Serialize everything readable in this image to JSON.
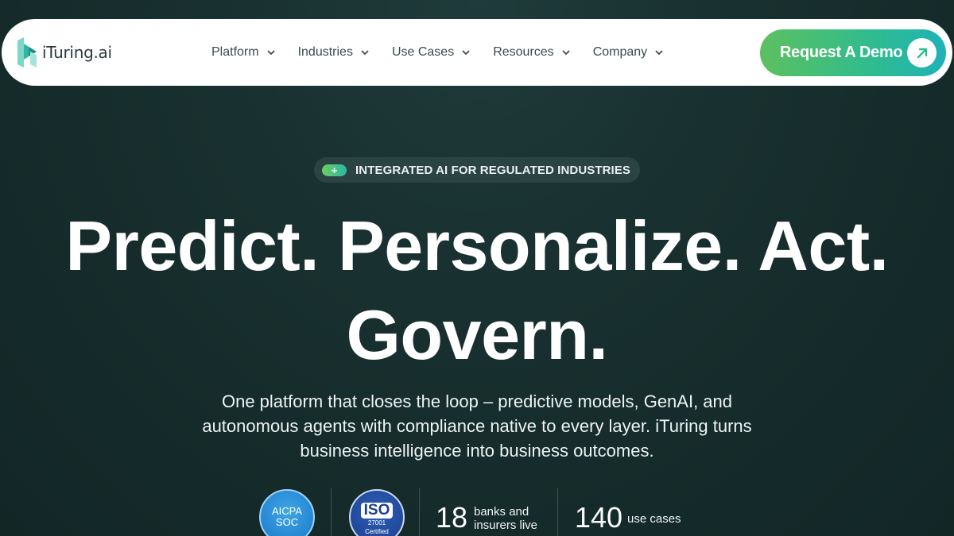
{
  "brand": {
    "name": "iTuring.ai",
    "logo_icon": "ituring-logo-icon"
  },
  "nav": {
    "items": [
      {
        "label": "Platform"
      },
      {
        "label": "Industries"
      },
      {
        "label": "Use Cases"
      },
      {
        "label": "Resources"
      },
      {
        "label": "Company"
      }
    ],
    "cta_label": "Request A Demo",
    "cta_icon": "arrow-up-right-icon"
  },
  "hero": {
    "badge_icon": "plus-icon",
    "badge_text": "INTEGRATED AI FOR REGULATED INDUSTRIES",
    "headline_line1": "Predict. Personalize. Act.",
    "headline_line2": "Govern.",
    "subtext": "One platform that closes the loop – predictive models, GenAI, and autonomous agents with compliance native to every layer. iTuring turns business intelligence into business outcomes."
  },
  "stats": {
    "aicpa": {
      "line1": "AICPA",
      "line2": "SOC"
    },
    "iso": {
      "main": "ISO",
      "code": "27001",
      "status": "Certified"
    },
    "banks": {
      "value": "18",
      "label_line1": "banks and",
      "label_line2": "insurers live"
    },
    "use_cases": {
      "value": "140",
      "label": "use cases"
    }
  },
  "colors": {
    "background": "#18302f",
    "cta_gradient_start": "#5dc05f",
    "cta_gradient_end": "#1fb2b8",
    "badge_background": "#2b4343"
  }
}
